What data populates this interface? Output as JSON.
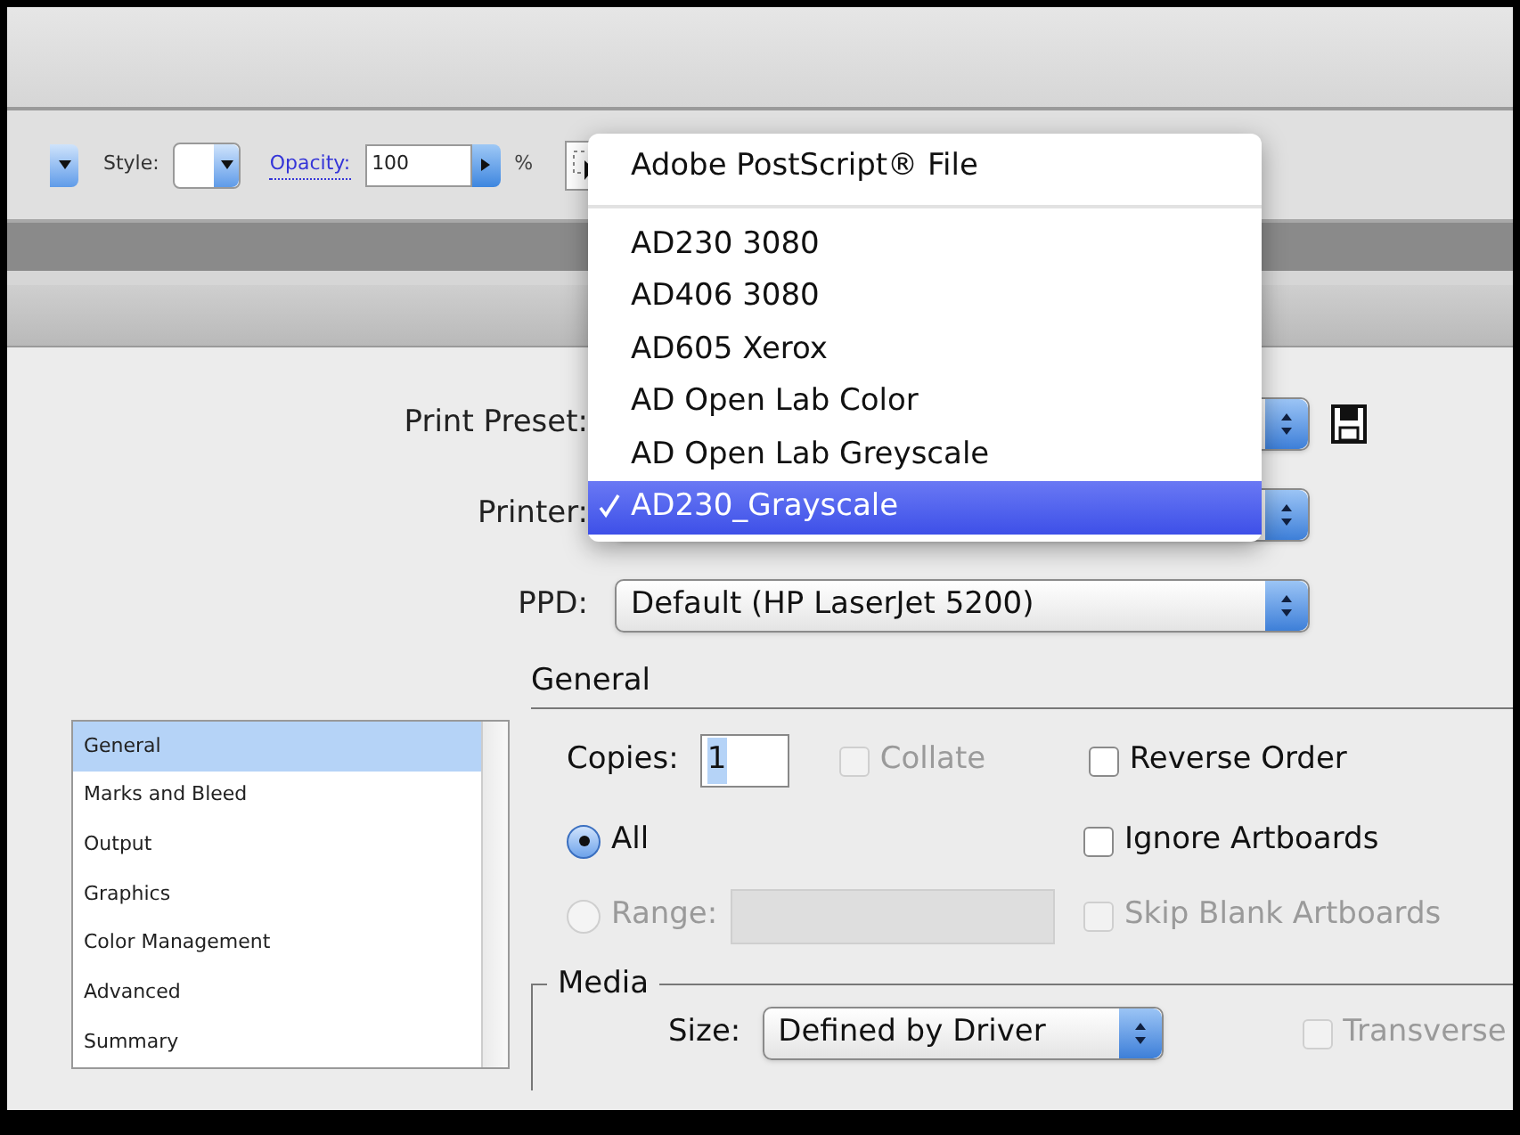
{
  "toolbar": {
    "style_label": "Style:",
    "opacity_label": "Opacity:",
    "opacity_value": "100",
    "percent": "%"
  },
  "dialog": {
    "print_preset_label": "Print Preset:",
    "printer_label": "Printer:",
    "ppd_label": "PPD:",
    "ppd_value": "Default (HP LaserJet 5200)"
  },
  "sections": [
    {
      "label": "General",
      "selected": true
    },
    {
      "label": "Marks and Bleed",
      "selected": false
    },
    {
      "label": "Output",
      "selected": false
    },
    {
      "label": "Graphics",
      "selected": false
    },
    {
      "label": "Color Management",
      "selected": false
    },
    {
      "label": "Advanced",
      "selected": false
    },
    {
      "label": "Summary",
      "selected": false
    }
  ],
  "general": {
    "heading": "General",
    "copies_label": "Copies:",
    "copies_value": "1",
    "collate": {
      "label": "Collate",
      "checked": false,
      "disabled": true
    },
    "reverse_order": {
      "label": "Reverse Order",
      "checked": false,
      "disabled": false
    },
    "ignore_artboards": {
      "label": "Ignore Artboards",
      "checked": false,
      "disabled": false
    },
    "skip_blank_artboards": {
      "label": "Skip Blank Artboards",
      "checked": false,
      "disabled": true
    },
    "all": {
      "label": "All",
      "selected": true,
      "disabled": false
    },
    "range": {
      "label": "Range:",
      "selected": false,
      "disabled": true
    }
  },
  "media": {
    "heading": "Media",
    "size_label": "Size:",
    "size_value": "Defined by Driver",
    "transverse": {
      "label": "Transverse",
      "checked": false,
      "disabled": true
    }
  },
  "printer_menu": {
    "items": [
      {
        "kind": "item",
        "label": "Adobe PostScript® File",
        "selected": false
      },
      {
        "kind": "separator"
      },
      {
        "kind": "item",
        "label": "AD230 3080",
        "selected": false
      },
      {
        "kind": "item",
        "label": "AD406 3080",
        "selected": false
      },
      {
        "kind": "item",
        "label": "AD605 Xerox",
        "selected": false
      },
      {
        "kind": "item",
        "label": "AD Open Lab Color",
        "selected": false
      },
      {
        "kind": "item",
        "label": "AD Open Lab Greyscale",
        "selected": false
      },
      {
        "kind": "item",
        "label": "AD230_Grayscale",
        "selected": true
      }
    ]
  }
}
